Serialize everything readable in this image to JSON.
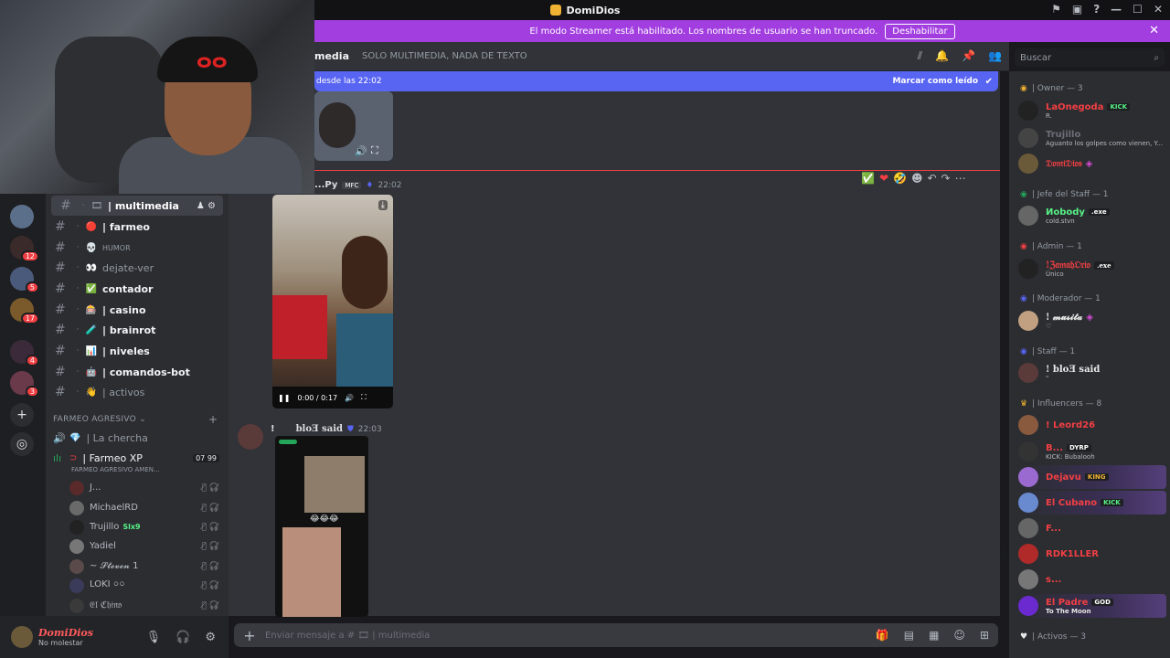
{
  "app": {
    "title": "DomiDios"
  },
  "banner": {
    "text": "El modo Streamer está habilitado. Los nombres de usuario se han truncado.",
    "button": "Deshabilitar"
  },
  "header": {
    "channel": "media",
    "topic": "SOLO MULTIMEDIA, NADA DE TEXTO",
    "search_placeholder": "Buscar"
  },
  "new_messages": {
    "since": "desde las 22:02",
    "mark_read": "Marcar como leído"
  },
  "channels": [
    {
      "name": "| multimedia",
      "emo": "🎞",
      "active": true,
      "bold": true
    },
    {
      "name": "| farmeo",
      "emo": "🔴",
      "bold": true
    },
    {
      "name": "HUMOR",
      "emo": "💀",
      "small": true
    },
    {
      "name": "dejate-ver",
      "emo": "👀"
    },
    {
      "name": "contador",
      "emo": "✅",
      "bold": true
    },
    {
      "name": "| casino",
      "emo": "🎰",
      "bold": true
    },
    {
      "name": "| brainrot",
      "emo": "🧪",
      "bold": true
    },
    {
      "name": "| niveles",
      "emo": "📊",
      "bold": true
    },
    {
      "name": "| comandos-bot",
      "emo": "🤖",
      "bold": true
    },
    {
      "name": "| activos",
      "emo": "👋"
    }
  ],
  "category": {
    "label": "FARMEO AGRESIVO ⌄"
  },
  "voice": {
    "la_chercha": "| La chercha",
    "farmeo_xp": "| Farmeo XP",
    "farmeo_xp_counts": "07  99",
    "farmeo_xp_sub": "FARMEO AGRESIVO AMEN...",
    "members": [
      "J...",
      "MichaelRD",
      "Trujillo",
      "Yadiel",
      "~ 𝓢𝓽𝓮𝓿𝓮𝓷 1",
      "LOKI ০০",
      "𝔈𝔩 ℭ𝔥𝔦𝔫𝔬"
    ],
    "trujillo_tag": "Slx9"
  },
  "user": {
    "name": "DomiDios",
    "status": "No molestar"
  },
  "message1": {
    "author": "...Py",
    "badge": "MFC",
    "time": "22:02",
    "video_time": "0:00 / 0:17"
  },
  "message2": {
    "author": "bloƎ said",
    "time": "22:03",
    "prefix": "!"
  },
  "composer": {
    "placeholder": "Enviar mensaje a #  🎞  |  multimedia"
  },
  "roles": {
    "owner": "| Owner — 3",
    "jefe": "| Jefe del Staff — 1",
    "admin": "| Admin — 1",
    "moderador": "| Moderador — 1",
    "staff": "| Staff — 1",
    "influencers": "| Influencers — 8",
    "activos": "| Activos — 3"
  },
  "members": {
    "owner": [
      {
        "name": "LaOnegoda",
        "tag": "KICK",
        "sub": "R.",
        "color": "#f23f43"
      },
      {
        "name": "Trujillo",
        "sub": "Aguanto los golpes como vienen, Y...",
        "color": "#e8e8e8"
      },
      {
        "name": "𝔇𝔬𝔪𝔦𝔇𝔦𝔬𝔰",
        "sub": "",
        "color": "#f23f43"
      }
    ],
    "jefe": [
      {
        "name": "Иobody",
        "tag": ".exe",
        "sub": "cold.stvn",
        "color": "#57f287"
      }
    ],
    "admin": [
      {
        "name": "!ℨ𝔞𝔪𝔞𝔥𝔒𝔯𝔦𝔬",
        "tag": ".exe",
        "sub": "Único",
        "color": "#f23f43"
      }
    ],
    "moderador": [
      {
        "name": "! 𝓶𝓾𝓼𝓲𝓽𝓪",
        "sub": "♡",
        "color": "#e8e8e8"
      }
    ],
    "staff": [
      {
        "name": "! bloƎ said",
        "sub": "\"",
        "color": "#e8e8e8"
      }
    ],
    "influencers": [
      {
        "name": "! Leord26",
        "color": "#f23f43"
      },
      {
        "name": "B...",
        "tag": "DYRP",
        "sub": "KICK: Bubalooh",
        "color": "#f23f43"
      },
      {
        "name": "Dejavu",
        "tag": "KING",
        "color": "#f23f43"
      },
      {
        "name": "El Cubano",
        "tag": "KICK",
        "color": "#f23f43"
      },
      {
        "name": "F...",
        "color": "#f23f43"
      },
      {
        "name": "RDK1LLER",
        "color": "#f23f43"
      },
      {
        "name": "s...",
        "color": "#f23f43"
      },
      {
        "name": "El Padre",
        "tag": "GOD",
        "sub": "To The Moon",
        "color": "#f23f43"
      }
    ]
  },
  "colors": {
    "accent": "#5865f2",
    "banner": "#a23ee0",
    "danger": "#f23f43"
  }
}
